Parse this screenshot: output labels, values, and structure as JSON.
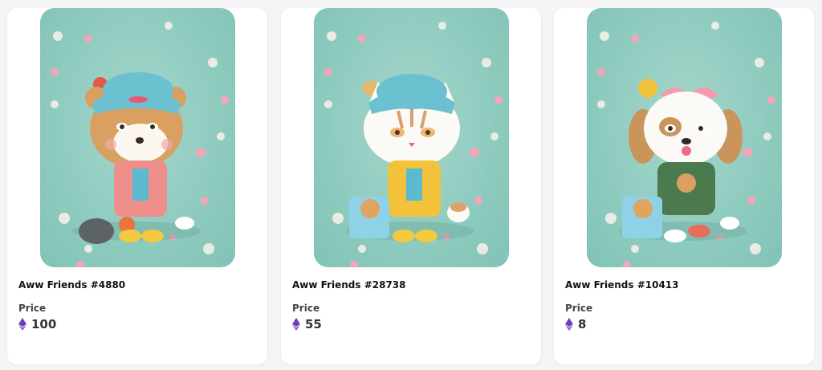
{
  "colors": {
    "art_bg": "#8ecbbf",
    "eth_icon": "#6b3fb7",
    "card_bg": "#ffffff",
    "page_bg": "#f4f4f6"
  },
  "currency_icon": "ethereum-icon",
  "cards": [
    {
      "name": "Aww Friends #4880",
      "price_label": "Price",
      "price": "100",
      "character": "bear-in-beanie"
    },
    {
      "name": "Aww Friends #28738",
      "price_label": "Price",
      "price": "55",
      "character": "cat-in-beanie"
    },
    {
      "name": "Aww Friends #10413",
      "price_label": "Price",
      "price": "8",
      "character": "dog-with-bow"
    }
  ]
}
